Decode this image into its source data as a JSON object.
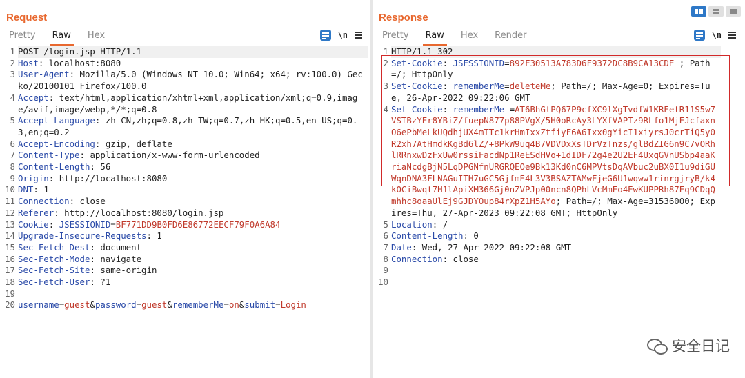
{
  "request": {
    "title": "Request",
    "tabs": [
      "Pretty",
      "Raw",
      "Hex"
    ],
    "active_tab": "Raw",
    "tools": {
      "newline_label": "\\n"
    },
    "lines": [
      [
        {
          "t": "op",
          "v": "POST /login.jsp HTTP/1.1"
        }
      ],
      [
        {
          "t": "hk",
          "v": "Host"
        },
        {
          "t": "op",
          "v": ": "
        },
        {
          "t": "hv",
          "v": "localhost:8080"
        }
      ],
      [
        {
          "t": "hk",
          "v": "User-Agent"
        },
        {
          "t": "op",
          "v": ": "
        },
        {
          "t": "hv",
          "v": "Mozilla/5.0 (Windows NT 10.0; Win64; x64; rv:100.0) Gecko/20100101 Firefox/100.0"
        }
      ],
      [
        {
          "t": "hk",
          "v": "Accept"
        },
        {
          "t": "op",
          "v": ": "
        },
        {
          "t": "hv",
          "v": "text/html,application/xhtml+xml,application/xml;q=0.9,image/avif,image/webp,*/*;q=0.8"
        }
      ],
      [
        {
          "t": "hk",
          "v": "Accept-Language"
        },
        {
          "t": "op",
          "v": ": "
        },
        {
          "t": "hv",
          "v": "zh-CN,zh;q=0.8,zh-TW;q=0.7,zh-HK;q=0.5,en-US;q=0.3,en;q=0.2"
        }
      ],
      [
        {
          "t": "hk",
          "v": "Accept-Encoding"
        },
        {
          "t": "op",
          "v": ": "
        },
        {
          "t": "hv",
          "v": "gzip, deflate"
        }
      ],
      [
        {
          "t": "hk",
          "v": "Content-Type"
        },
        {
          "t": "op",
          "v": ": "
        },
        {
          "t": "hv",
          "v": "application/x-www-form-urlencoded"
        }
      ],
      [
        {
          "t": "hk",
          "v": "Content-Length"
        },
        {
          "t": "op",
          "v": ": "
        },
        {
          "t": "hv",
          "v": "56"
        }
      ],
      [
        {
          "t": "hk",
          "v": "Origin"
        },
        {
          "t": "op",
          "v": ": "
        },
        {
          "t": "hv",
          "v": "http://localhost:8080"
        }
      ],
      [
        {
          "t": "hk",
          "v": "DNT"
        },
        {
          "t": "op",
          "v": ": "
        },
        {
          "t": "hv",
          "v": "1"
        }
      ],
      [
        {
          "t": "hk",
          "v": "Connection"
        },
        {
          "t": "op",
          "v": ": "
        },
        {
          "t": "hv",
          "v": "close"
        }
      ],
      [
        {
          "t": "hk",
          "v": "Referer"
        },
        {
          "t": "op",
          "v": ": "
        },
        {
          "t": "hv",
          "v": "http://localhost:8080/login.jsp"
        }
      ],
      [
        {
          "t": "hk",
          "v": "Cookie"
        },
        {
          "t": "op",
          "v": ": "
        },
        {
          "t": "ck",
          "v": "JSESSIONID"
        },
        {
          "t": "op",
          "v": "="
        },
        {
          "t": "cv",
          "v": "BF771DD9B0FD6E86772EECF79F0A6A84"
        }
      ],
      [
        {
          "t": "hk",
          "v": "Upgrade-Insecure-Requests"
        },
        {
          "t": "op",
          "v": ": "
        },
        {
          "t": "hv",
          "v": "1"
        }
      ],
      [
        {
          "t": "hk",
          "v": "Sec-Fetch-Dest"
        },
        {
          "t": "op",
          "v": ": "
        },
        {
          "t": "hv",
          "v": "document"
        }
      ],
      [
        {
          "t": "hk",
          "v": "Sec-Fetch-Mode"
        },
        {
          "t": "op",
          "v": ": "
        },
        {
          "t": "hv",
          "v": "navigate"
        }
      ],
      [
        {
          "t": "hk",
          "v": "Sec-Fetch-Site"
        },
        {
          "t": "op",
          "v": ": "
        },
        {
          "t": "hv",
          "v": "same-origin"
        }
      ],
      [
        {
          "t": "hk",
          "v": "Sec-Fetch-User"
        },
        {
          "t": "op",
          "v": ": "
        },
        {
          "t": "hv",
          "v": "?1"
        }
      ],
      [],
      [
        {
          "t": "ck",
          "v": "username"
        },
        {
          "t": "op",
          "v": "="
        },
        {
          "t": "cv",
          "v": "guest"
        },
        {
          "t": "op",
          "v": "&"
        },
        {
          "t": "ck",
          "v": "password"
        },
        {
          "t": "op",
          "v": "="
        },
        {
          "t": "cv",
          "v": "guest"
        },
        {
          "t": "op",
          "v": "&"
        },
        {
          "t": "ck",
          "v": "rememberMe"
        },
        {
          "t": "op",
          "v": "="
        },
        {
          "t": "cv",
          "v": "on"
        },
        {
          "t": "op",
          "v": "&"
        },
        {
          "t": "ck",
          "v": "submit"
        },
        {
          "t": "op",
          "v": "="
        },
        {
          "t": "cv",
          "v": "Login"
        }
      ]
    ]
  },
  "response": {
    "title": "Response",
    "tabs": [
      "Pretty",
      "Raw",
      "Hex",
      "Render"
    ],
    "active_tab": "Raw",
    "tools": {
      "newline_label": "\\n"
    },
    "lines": [
      [
        {
          "t": "op",
          "v": "HTTP/1.1 302"
        }
      ],
      [
        {
          "t": "hk",
          "v": "Set-Cookie"
        },
        {
          "t": "op",
          "v": ": "
        },
        {
          "t": "ck",
          "v": "JSESSIONID"
        },
        {
          "t": "op",
          "v": "="
        },
        {
          "t": "cv",
          "v": "892F30513A783D6F9372DC8B9CA13CDE"
        },
        {
          "t": "op",
          "v": " ; Path=/; HttpOnly"
        }
      ],
      [
        {
          "t": "hk",
          "v": "Set-Cookie"
        },
        {
          "t": "op",
          "v": ": "
        },
        {
          "t": "ck",
          "v": "rememberMe"
        },
        {
          "t": "op",
          "v": "="
        },
        {
          "t": "cv",
          "v": "deleteMe"
        },
        {
          "t": "op",
          "v": "; Path=/; Max-Age=0; Expires=Tue, 26-Apr-2022 09:22:06 GMT"
        }
      ],
      [
        {
          "t": "hk",
          "v": "Set-Cookie"
        },
        {
          "t": "op",
          "v": ": "
        },
        {
          "t": "ck",
          "v": "rememberMe"
        },
        {
          "t": "op",
          "v": " ="
        },
        {
          "t": "cv",
          "v": "AT6BhGtPQ67P9cfXC9lXgTvdfW1KREetR11S5w7VSTBzYEr8YBiZ/fuepN877p88PVgX/5H0oRcAy3LYXfVAPTz9RLfo1MjEJcfaxnO6ePbMeLkUQdhjUX4mTTc1krHmIxxZtfiyF6A6Ixx0gYicI1xiyrsJ0crTiQ5y0R2xh7AtHmdkKgBd6lZ/+8PkW9uq4B7VDVDxXsTDrVzTnzs/glBdZIG6n9C7vORhlRRnxwDzFxUw0rssiFacdNp1ReESdHVo+1dIDF72g4e2U2EF4UxqGVnUSbp4aaKriaNcdgBjN5LqDPGNfnURGRQEOe9Bk13Kd0nC6MPVtsDqAVbuc2uBX0I1u9diGUWqnDNA3FLNAGuITH7uGC5GjfmE4L3V3BSAZTAMwFjeG6U1wqww1rinrgjryB/k4kOCiBwqt7H1lApiXM366Gj0nZVPJp00ncn8QPhLVcMmEo4EwKUPPRh87Eq9CDqQmhhc8oaaUlEj9GJDYOup84rXpZ1H5AYo"
        },
        {
          "t": "op",
          "v": "; Path=/; Max-Age=31536000; Expires=Thu, 27-Apr-2023 09:22:08 GMT; HttpOnly"
        }
      ],
      [
        {
          "t": "hk",
          "v": "Location"
        },
        {
          "t": "op",
          "v": ": "
        },
        {
          "t": "hv",
          "v": "/"
        }
      ],
      [
        {
          "t": "hk",
          "v": "Content-Length"
        },
        {
          "t": "op",
          "v": ": "
        },
        {
          "t": "hv",
          "v": "0"
        }
      ],
      [
        {
          "t": "hk",
          "v": "Date"
        },
        {
          "t": "op",
          "v": ": "
        },
        {
          "t": "hv",
          "v": "Wed, 27 Apr 2022 09:22:08 GMT"
        }
      ],
      [
        {
          "t": "hk",
          "v": "Connection"
        },
        {
          "t": "op",
          "v": ": "
        },
        {
          "t": "hv",
          "v": "close"
        }
      ],
      [],
      []
    ]
  },
  "watermark": {
    "text": "安全日记"
  }
}
